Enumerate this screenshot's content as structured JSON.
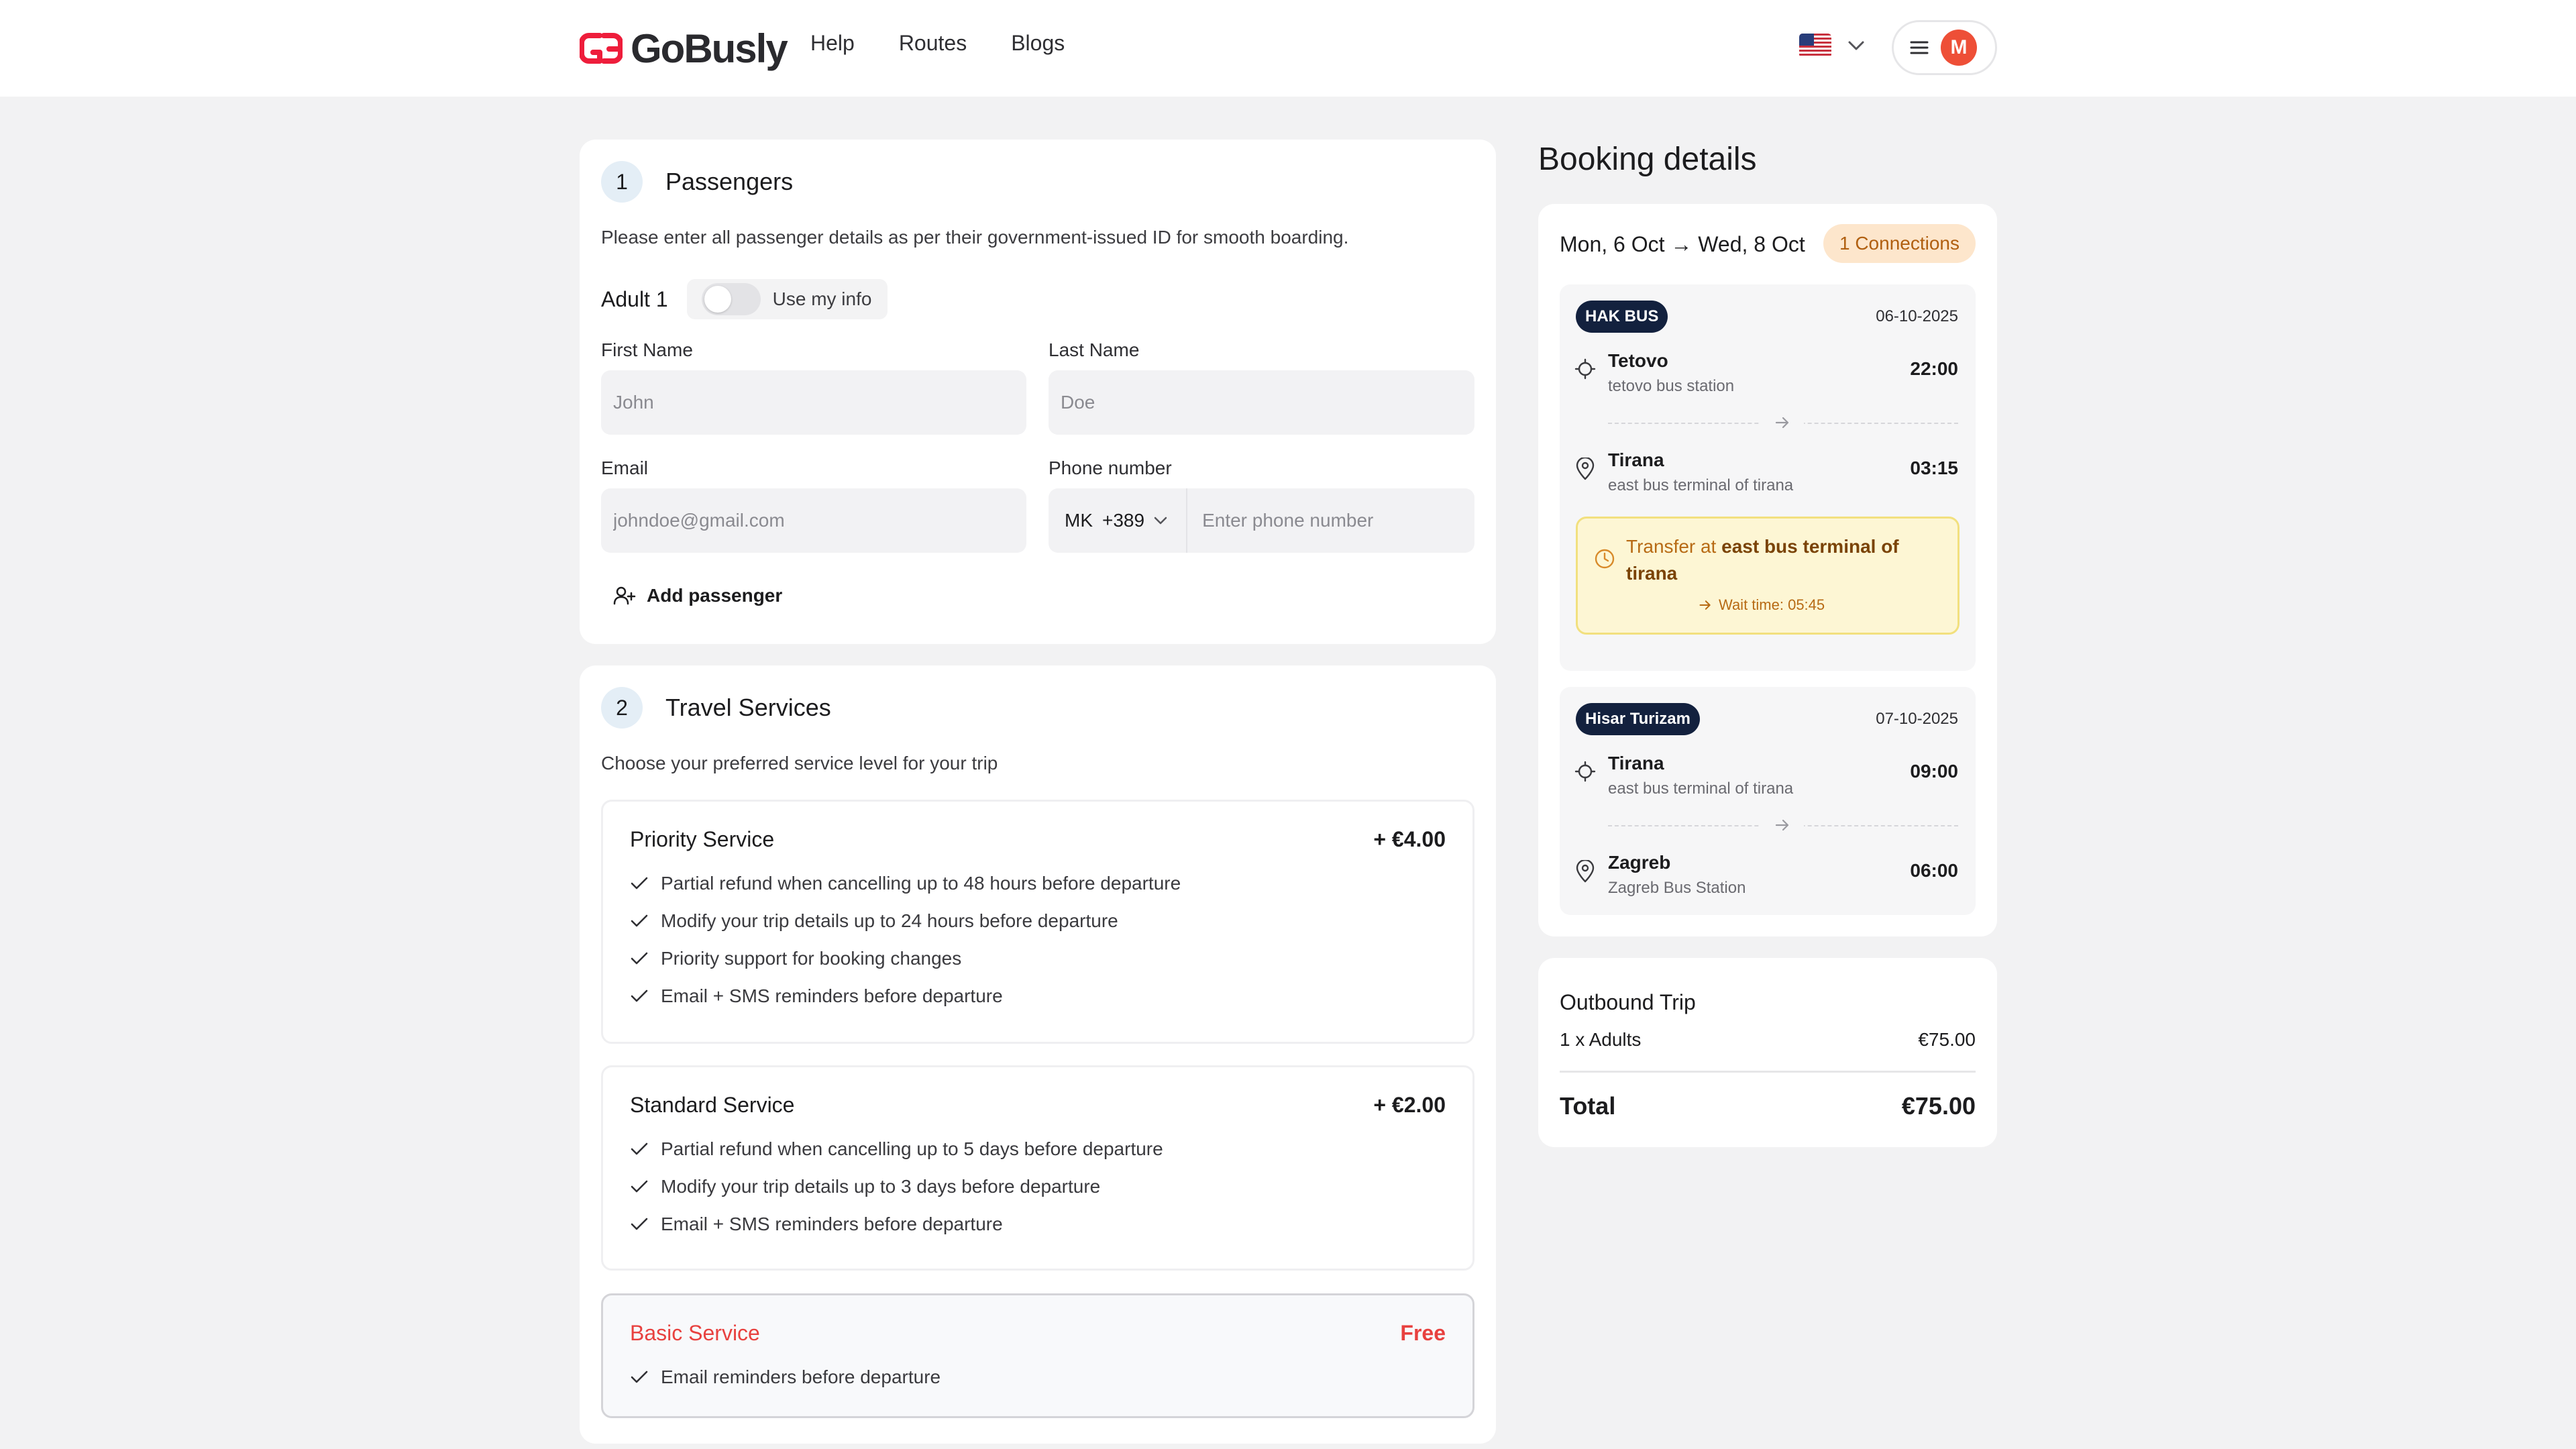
{
  "header": {
    "brand": "GoBusly",
    "nav": [
      "Help",
      "Routes",
      "Blogs"
    ],
    "avatar_initial": "M",
    "language_flag": "us-flag-icon",
    "colors": {
      "brand": "#ee1d3b",
      "avatar": "#ee4f37"
    }
  },
  "passengers": {
    "step": "1",
    "title": "Passengers",
    "description": "Please enter all passenger details as per their government-issued ID for smooth boarding.",
    "adult_label": "Adult 1",
    "use_my_info": "Use my info",
    "first_name": {
      "label": "First Name",
      "placeholder": "John",
      "value": ""
    },
    "last_name": {
      "label": "Last Name",
      "placeholder": "Doe",
      "value": ""
    },
    "email": {
      "label": "Email",
      "placeholder": "johndoe@gmail.com",
      "value": ""
    },
    "phone": {
      "label": "Phone number",
      "country": "MK",
      "code": "+389",
      "placeholder": "Enter phone number",
      "value": ""
    },
    "add_passenger": "Add passenger"
  },
  "travel_services": {
    "step": "2",
    "title": "Travel Services",
    "description": "Choose your preferred service level for your trip",
    "services": [
      {
        "name": "Priority Service",
        "price": "+ €4.00",
        "features": [
          "Partial refund when cancelling up to 48 hours before departure",
          "Modify your trip details up to 24 hours before departure",
          "Priority support for booking changes",
          "Email + SMS reminders before departure"
        ]
      },
      {
        "name": "Standard Service",
        "price": "+ €2.00",
        "features": [
          "Partial refund when cancelling up to 5 days before departure",
          "Modify your trip details up to 3 days before departure",
          "Email + SMS reminders before departure"
        ]
      },
      {
        "name": "Basic Service",
        "price": "Free",
        "selected": true,
        "features": [
          "Email reminders before departure"
        ]
      }
    ],
    "colors": {
      "selected_accent": "#e8413f"
    }
  },
  "booking": {
    "title": "Booking details",
    "dates": "Mon, 6 Oct → Wed, 8 Oct",
    "connections": "1 Connections",
    "legs": [
      {
        "operator": "HAK BUS",
        "date": "06-10-2025",
        "from": {
          "city": "Tetovo",
          "station": "tetovo bus station",
          "time": "22:00"
        },
        "to": {
          "city": "Tirana",
          "station": "east bus terminal of tirana",
          "time": "03:15"
        }
      },
      {
        "operator": "Hisar Turizam",
        "date": "07-10-2025",
        "from": {
          "city": "Tirana",
          "station": "east bus terminal of tirana",
          "time": "09:00"
        },
        "to": {
          "city": "Zagreb",
          "station": "Zagreb Bus Station",
          "time": "06:00"
        }
      }
    ],
    "transfer": {
      "prefix": "Transfer at ",
      "location": "east bus terminal of tirana",
      "wait": "Wait time: 05:45"
    }
  },
  "summary": {
    "title": "Outbound Trip",
    "line_label": "1 x Adults",
    "line_value": "€75.00",
    "total_label": "Total",
    "total_value": "€75.00"
  }
}
